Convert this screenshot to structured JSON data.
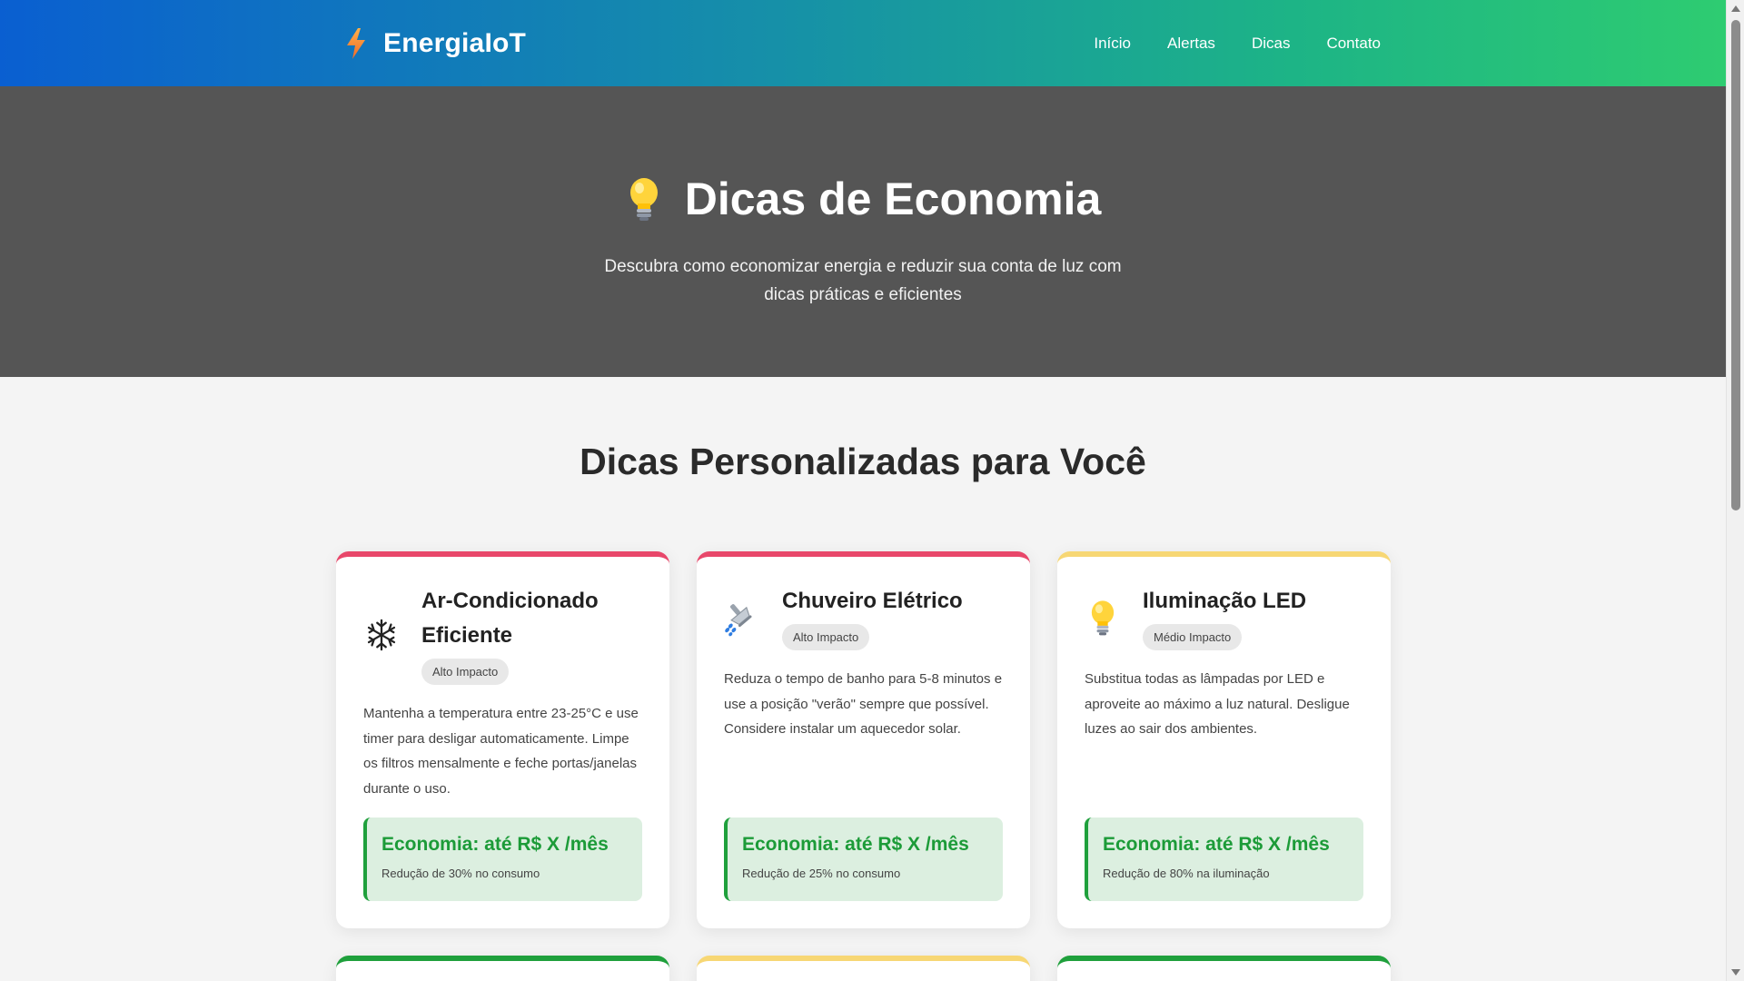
{
  "header": {
    "brand": "EnergiaIoT",
    "brand_icon": "lightning-bolt-icon",
    "nav": [
      "Início",
      "Alertas",
      "Dicas",
      "Contato"
    ]
  },
  "hero": {
    "icon": "lightbulb-icon",
    "title": "Dicas de Economia",
    "subtitle": "Descubra como economizar energia e reduzir sua conta de luz com dicas práticas e eficientes"
  },
  "section": {
    "title": "Dicas Personalizadas para Você"
  },
  "cards": [
    {
      "icon": "snowflake-icon",
      "title": "Ar-Condicionado Eficiente",
      "badge": "Alto Impacto",
      "text": "Mantenha a temperatura entre 23-25°C e use timer para desligar automaticamente. Limpe os filtros mensalmente e feche portas/janelas durante o uso.",
      "saving_title": "Economia: até R$ X /mês",
      "saving_sub": "Redução de 30% no consumo",
      "accent": "#e8476a"
    },
    {
      "icon": "shower-icon",
      "title": "Chuveiro Elétrico",
      "badge": "Alto Impacto",
      "text": "Reduza o tempo de banho para 5-8 minutos e use a posição \"verão\" sempre que possível. Considere instalar um aquecedor solar.",
      "saving_title": "Economia: até R$ X /mês",
      "saving_sub": "Redução de 25% no consumo",
      "accent": "#e8476a"
    },
    {
      "icon": "lightbulb-icon",
      "title": "Iluminação LED",
      "badge": "Médio Impacto",
      "text": "Substitua todas as lâmpadas por LED e aproveite ao máximo a luz natural. Desligue luzes ao sair dos ambientes.",
      "saving_title": "Economia: até R$ X /mês",
      "saving_sub": "Redução de 80% na iluminação",
      "accent": "#f7d774"
    }
  ],
  "colors": {
    "header_gradient_start": "#0a5fd1",
    "header_gradient_end": "#2ecc71",
    "hero_bg": "#555555",
    "saving_green": "#1c9b38",
    "high_impact": "#e8476a",
    "medium_impact": "#f7d774",
    "low_impact": "#1fa03c"
  }
}
